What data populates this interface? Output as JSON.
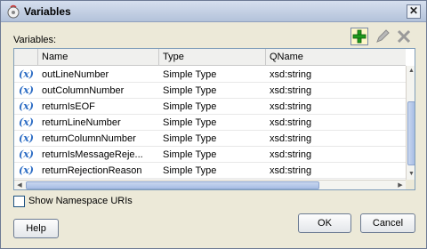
{
  "window": {
    "title": "Variables",
    "close_glyph": "✕"
  },
  "variables_label": "Variables:",
  "toolbar": {
    "add_icon": "plus-icon",
    "edit_icon": "pencil-icon",
    "delete_icon": "x-icon"
  },
  "table": {
    "columns": [
      "",
      "Name",
      "Type",
      "QName"
    ],
    "row_icon_text": "(x)",
    "rows": [
      {
        "name": "outLineNumber",
        "type": "Simple Type",
        "qname": "xsd:string"
      },
      {
        "name": "outColumnNumber",
        "type": "Simple Type",
        "qname": "xsd:string"
      },
      {
        "name": "returnIsEOF",
        "type": "Simple Type",
        "qname": "xsd:string"
      },
      {
        "name": "returnLineNumber",
        "type": "Simple Type",
        "qname": "xsd:string"
      },
      {
        "name": "returnColumnNumber",
        "type": "Simple Type",
        "qname": "xsd:string"
      },
      {
        "name": "returnIsMessageReje...",
        "type": "Simple Type",
        "qname": "xsd:string"
      },
      {
        "name": "returnRejectionReason",
        "type": "Simple Type",
        "qname": "xsd:string"
      }
    ]
  },
  "show_ns": {
    "label": "Show Namespace URIs",
    "checked": false
  },
  "buttons": {
    "help": "Help",
    "ok": "OK",
    "cancel": "Cancel"
  }
}
